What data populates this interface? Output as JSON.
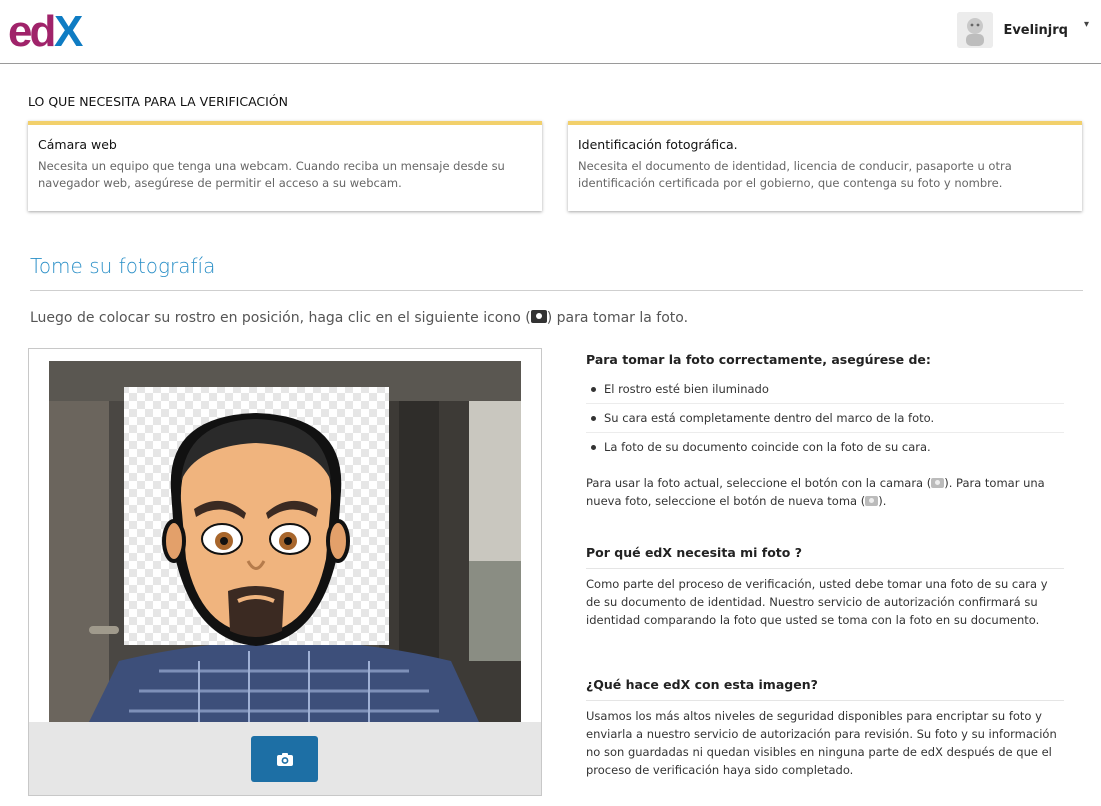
{
  "header": {
    "logo_text": "edX",
    "username": "Evelinjrq",
    "user_menu_icon": "caret-down-icon"
  },
  "requirements": {
    "title": "LO QUE NECESITA PARA LA VERIFICACIÓN",
    "cards": [
      {
        "title": "Cámara web",
        "text": "Necesita un equipo que tenga una webcam. Cuando reciba un mensaje desde su navegador web, asegúrese de permitir el acceso a su webcam."
      },
      {
        "title": "Identificación fotográfica.",
        "text": "Necesita el documento de identidad, licencia de conducir, pasaporte u otra identificación certificada por el gobierno, que contenga su foto y nombre."
      }
    ]
  },
  "photo_step": {
    "title": "Tome su fotografía",
    "instructions_before": "Luego de colocar su rostro en posición, haga clic en el siguiente icono (",
    "instructions_after": ") para tomar la foto.",
    "capture_icon": "camera-icon"
  },
  "help": {
    "tips_title": "Para tomar la foto correctamente, asegúrese de:",
    "tips": [
      "El rostro esté bien iluminado",
      "Su cara está completamente dentro del marco de la foto.",
      "La foto de su documento coincide con la foto de su cara."
    ],
    "usage_part1": "Para usar la foto actual, seleccione el botón con la camara (",
    "usage_part2": "). Para tomar una nueva foto, seleccione el botón de nueva toma (",
    "usage_part3": ").",
    "why_title": "Por qué edX necesita mi foto ?",
    "why_text": "Como parte del proceso de verificación, usted debe tomar una foto de su cara y de su documento de identidad. Nuestro servicio de autorización confirmará su identidad comparando la foto que usted se toma con la foto en su documento.",
    "what_title": "¿Qué hace edX con esta imagen?",
    "what_text": "Usamos los más altos niveles de seguridad disponibles para encriptar su foto y enviarla a nuestro servicio de autorización para revisión. Su foto y su información no son guardadas ni quedan visibles en ninguna parte de edX después de que el proceso de verificación haya sido completado."
  },
  "colors": {
    "brand_logo": "#a0236a",
    "brand_x": "#0f7cc3",
    "accent_blue": "#1d6fa5",
    "card_top_border": "#f2d06b"
  }
}
